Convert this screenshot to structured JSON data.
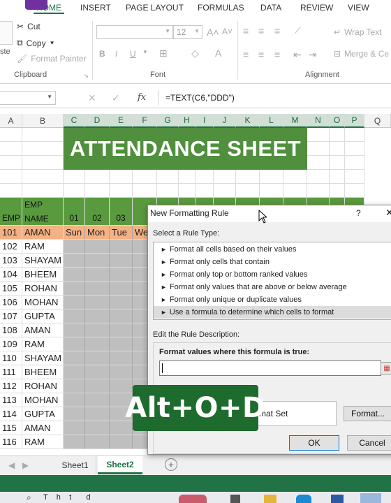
{
  "ribbon_tabs": [
    "HOME",
    "INSERT",
    "PAGE LAYOUT",
    "FORMULAS",
    "DATA",
    "REVIEW",
    "VIEW"
  ],
  "clipboard": {
    "cut": "Cut",
    "copy": "Copy",
    "format_painter": "Format Painter",
    "paste_partial": "ste",
    "group_label": "Clipboard"
  },
  "font": {
    "size": "12",
    "bold": "B",
    "italic": "I",
    "underline": "U",
    "font_color": "A",
    "group_label": "Font"
  },
  "alignment": {
    "wrap_text": "Wrap Text",
    "merge": "Merge & Ce",
    "group_label": "Alignment"
  },
  "formula_bar": {
    "fx": "fx",
    "formula": "=TEXT(C6,\"DDD\")"
  },
  "columns": [
    "A",
    "B",
    "C",
    "D",
    "E",
    "F",
    "G",
    "H",
    "I",
    "J",
    "K",
    "L",
    "M",
    "N",
    "O",
    "P",
    "Q"
  ],
  "sheet": {
    "title": "ATTENDANCE SHEET",
    "hdr_emp": "EMP",
    "hdr_emp_name": "EMP NAME",
    "day_nums": [
      "01",
      "02",
      "03"
    ],
    "days": [
      "Sun",
      "Mon",
      "Tue",
      "We"
    ],
    "rows": [
      {
        "id": "101",
        "name": "AMAN"
      },
      {
        "id": "102",
        "name": "RAM"
      },
      {
        "id": "103",
        "name": "SHAYAM"
      },
      {
        "id": "104",
        "name": "BHEEM"
      },
      {
        "id": "105",
        "name": "ROHAN"
      },
      {
        "id": "106",
        "name": "MOHAN"
      },
      {
        "id": "107",
        "name": "GUPTA"
      },
      {
        "id": "108",
        "name": "AMAN"
      },
      {
        "id": "109",
        "name": "RAM"
      },
      {
        "id": "110",
        "name": "SHAYAM"
      },
      {
        "id": "111",
        "name": "BHEEM"
      },
      {
        "id": "112",
        "name": "ROHAN"
      },
      {
        "id": "113",
        "name": "MOHAN"
      },
      {
        "id": "114",
        "name": "GUPTA"
      },
      {
        "id": "115",
        "name": "AMAN"
      },
      {
        "id": "116",
        "name": "RAM"
      }
    ]
  },
  "sheet_tabs": [
    "Sheet1",
    "Sheet2"
  ],
  "dialog": {
    "title": "New Formatting Rule",
    "help": "?",
    "select_label": "Select a Rule Type:",
    "rule_types": [
      "Format all cells based on their values",
      "Format only cells that contain",
      "Format only top or bottom ranked values",
      "Format only values that are above or below average",
      "Format only unique or duplicate values",
      "Use a formula to determine which cells to format"
    ],
    "edit_label": "Edit the Rule Description:",
    "formula_label": "Format values where this formula is true:",
    "preview_partial": "rmat Set",
    "format_button": "Format...",
    "ok": "OK",
    "cancel": "Cancel"
  },
  "overlay": {
    "shortcut": "Alt+O+D"
  },
  "taskbar": {
    "search_partial": "T    h    t       d"
  },
  "colors": {
    "excel_green": "#217346",
    "title_green": "#4f8f3d",
    "header_green": "#5a9a3e",
    "highlight_row": "#f4b183",
    "day_cell": "#bfbfbf"
  }
}
